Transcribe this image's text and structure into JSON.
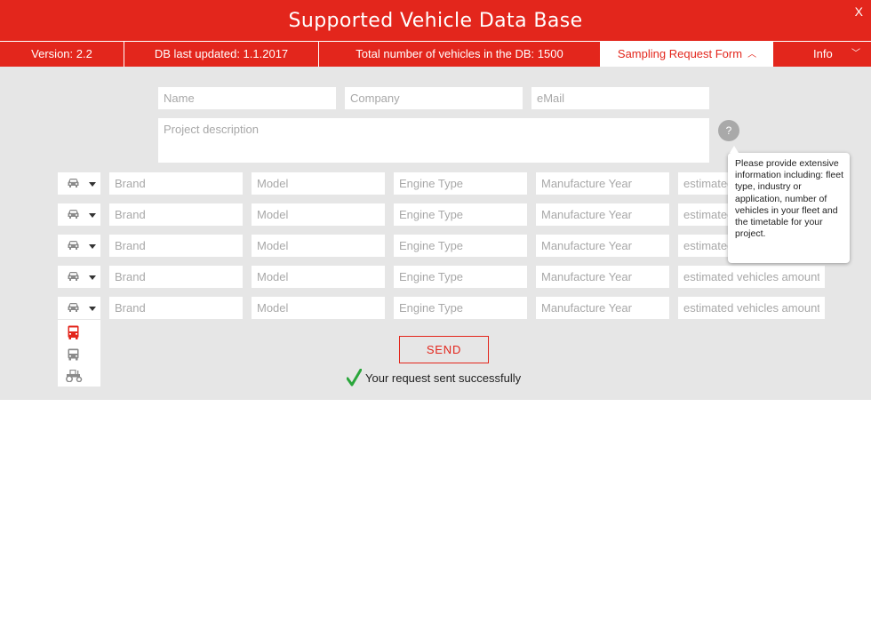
{
  "header": {
    "title": "Supported Vehicle Data Base",
    "close_label": "X"
  },
  "infobar": {
    "version": "Version: 2.2",
    "db_updated": "DB last updated: 1.1.2017",
    "total_vehicles": "Total number of vehicles in the DB: 1500",
    "sampling_tab": "Sampling Request Form",
    "sampling_chevron": "chevron-up-icon",
    "info_tab": "Info",
    "info_chevron": "chevron-down-icon"
  },
  "form": {
    "name_placeholder": "Name",
    "company_placeholder": "Company",
    "email_placeholder": "eMail",
    "project_placeholder": "Project description",
    "help_label": "?",
    "tooltip": "Please provide extensive information including: fleet type, industry or application, number of vehicles in your fleet and the timetable for your project.",
    "rows": [
      {
        "vehicle_icon": "car-icon",
        "brand": "Brand",
        "model": "Model",
        "engine": "Engine Type",
        "year": "Manufacture Year",
        "amount": "estimated vehicles amount"
      },
      {
        "vehicle_icon": "car-icon",
        "brand": "Brand",
        "model": "Model",
        "engine": "Engine Type",
        "year": "Manufacture Year",
        "amount": "estimated vehicles amount"
      },
      {
        "vehicle_icon": "car-icon",
        "brand": "Brand",
        "model": "Model",
        "engine": "Engine Type",
        "year": "Manufacture Year",
        "amount": "estimated vehicles amount"
      },
      {
        "vehicle_icon": "car-icon",
        "brand": "Brand",
        "model": "Model",
        "engine": "Engine Type",
        "year": "Manufacture Year",
        "amount": "estimated vehicles amount"
      },
      {
        "vehicle_icon": "car-icon",
        "brand": "Brand",
        "model": "Model",
        "engine": "Engine Type",
        "year": "Manufacture Year",
        "amount": "estimated vehicles amount"
      }
    ],
    "vehicle_options": [
      "truck-icon",
      "bus-icon",
      "tractor-icon"
    ],
    "send_label": "SEND",
    "success_message": "Your request sent successfully"
  },
  "colors": {
    "accent": "#e3261c",
    "panel": "#e6e6e6",
    "success": "#2aa63b"
  }
}
